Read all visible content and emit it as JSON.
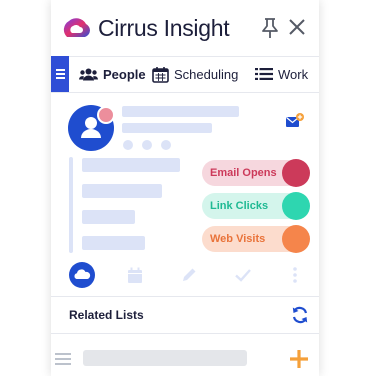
{
  "app": {
    "brand_name": "Cirrus Insight"
  },
  "nav": {
    "tabs": [
      {
        "label": "People",
        "icon": "people-icon",
        "active": true
      },
      {
        "label": "Scheduling",
        "icon": "calendar-icon",
        "active": false
      },
      {
        "label": "Work",
        "icon": "list-icon",
        "active": false
      }
    ]
  },
  "profile": {
    "engagement": [
      {
        "label": "Email Opens",
        "color": "#cc3a5a",
        "bg": "#f6d7de",
        "text_color": "#cc3a5a"
      },
      {
        "label": "Link Clicks",
        "color": "#2ed6b0",
        "bg": "#d4f5ec",
        "text_color": "#1fb993"
      },
      {
        "label": "Web Visits",
        "color": "#f5854b",
        "bg": "#fcdccd",
        "text_color": "#e9733a"
      }
    ]
  },
  "related_lists": {
    "title": "Related Lists"
  },
  "colors": {
    "accent": "#2f4ed6",
    "placeholder": "#dce3f7",
    "add": "#f5a03a"
  }
}
